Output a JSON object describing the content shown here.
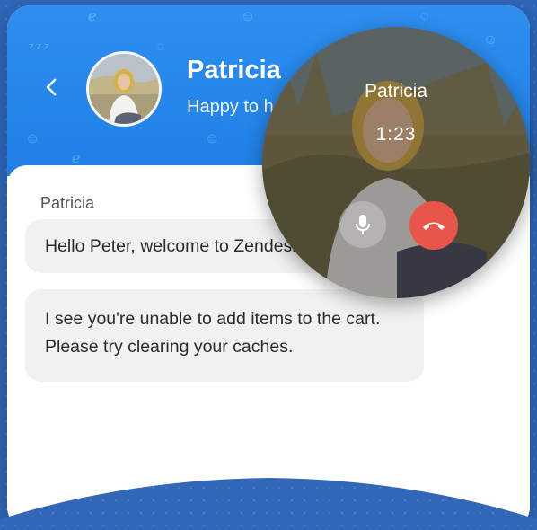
{
  "chat": {
    "contact_name": "Patricia",
    "status_text": "Happy to help",
    "messages": [
      {
        "sender": "Patricia",
        "text": "Hello Peter, welcome to Zendesk"
      },
      {
        "text": "I see you're unable to add items to the cart. Please try clearing your caches."
      }
    ]
  },
  "call": {
    "caller_name": "Patricia",
    "duration": "1:23"
  },
  "icons": {
    "back": "chevron-left-icon",
    "mute": "microphone-icon",
    "hangup": "phone-hangup-icon"
  },
  "colors": {
    "header_blue": "#2e8ff0",
    "background_blue": "#2f66b8",
    "hangup_red": "#e8564b",
    "bubble_gray": "#f1f1f1"
  }
}
